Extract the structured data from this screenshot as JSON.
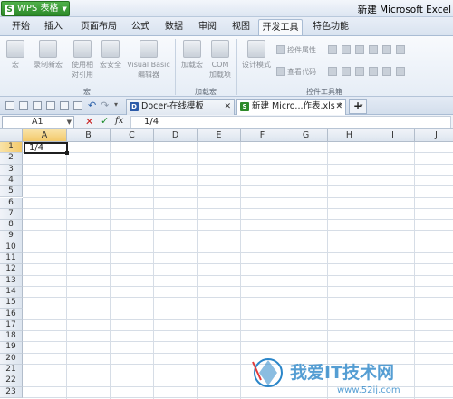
{
  "title_bar": {
    "app_button": "WPS 表格",
    "app_logo": "S",
    "window_title": "新建 Microsoft Excel"
  },
  "ribbon_tabs": [
    "开始",
    "插入",
    "页面布局",
    "公式",
    "数据",
    "审阅",
    "视图",
    "开发工具",
    "特色功能"
  ],
  "active_tab": "开发工具",
  "ribbon": {
    "macro_group": {
      "label": "宏",
      "buttons": [
        "宏",
        "录制新宏",
        "使用相对引用",
        "宏安全",
        "Visual Basic 编辑器"
      ],
      "relative_line1": "使用相",
      "relative_line2": "对引用",
      "vb_line1": "Visual Basic",
      "vb_line2": "编辑器"
    },
    "addin_group": {
      "label": "加载宏",
      "buttons": [
        "加载宏",
        "COM 加载项"
      ],
      "com_line1": "COM",
      "com_line2": "加载项"
    },
    "controls_group": {
      "label": "控件工具箱",
      "design_mode": "设计模式",
      "properties": "控件属性",
      "view_code": "查看代码"
    }
  },
  "doc_tabs": [
    {
      "icon": "D",
      "label": "Docer-在线模板",
      "active": false
    },
    {
      "icon": "S",
      "label": "新建 Micro...作表.xls *",
      "active": true
    }
  ],
  "new_tab_symbol": "+",
  "formula_bar": {
    "name_box": "A1",
    "fx": "fx",
    "cancel_symbol": "✕",
    "ok_symbol": "✓",
    "content": "1/4"
  },
  "columns": [
    "A",
    "B",
    "C",
    "D",
    "E",
    "F",
    "G",
    "H",
    "I",
    "J"
  ],
  "rows": [
    1,
    2,
    3,
    4,
    5,
    6,
    7,
    8,
    9,
    10,
    11,
    12,
    13,
    14,
    15,
    16,
    17,
    18,
    19,
    20,
    21,
    22,
    23
  ],
  "cells": {
    "A1": "1/4"
  },
  "selected_cell": "A1",
  "watermark": {
    "text": "我爱IT技术网",
    "url": "www.52ij.com"
  },
  "colors": {
    "accent_green": "#2d8a29",
    "selection": "#f3c96a",
    "grid": "#d6dde6"
  }
}
